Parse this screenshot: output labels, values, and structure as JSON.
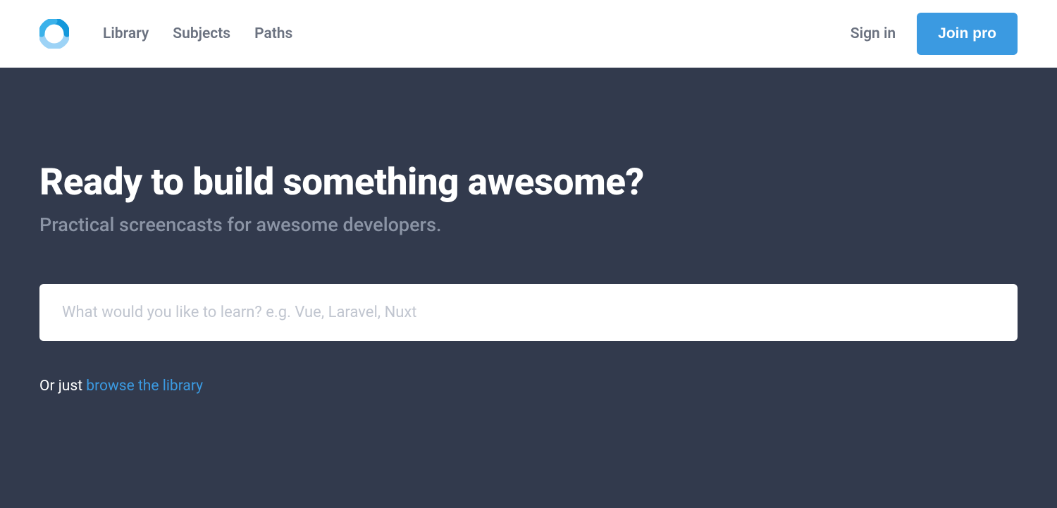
{
  "header": {
    "nav": {
      "library": "Library",
      "subjects": "Subjects",
      "paths": "Paths"
    },
    "sign_in": "Sign in",
    "join_pro": "Join pro"
  },
  "hero": {
    "title": "Ready to build something awesome?",
    "subtitle": "Practical screencasts for awesome developers.",
    "search_placeholder": "What would you like to learn? e.g. Vue, Laravel, Nuxt",
    "browse_prefix": "Or just ",
    "browse_link": "browse the library"
  },
  "colors": {
    "accent": "#3b9ae1",
    "hero_bg": "#323a4d",
    "text_muted": "#6b7280"
  }
}
